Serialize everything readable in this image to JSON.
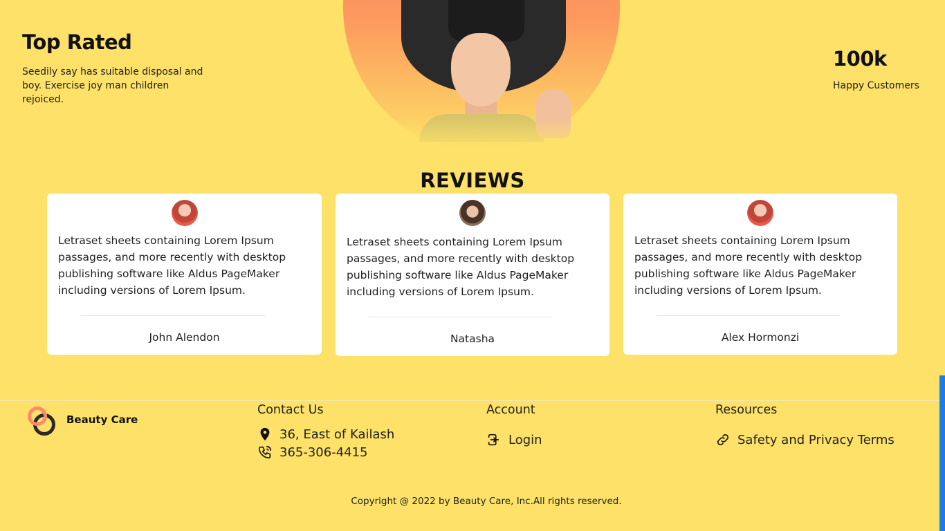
{
  "top_rated": {
    "title": "Top Rated",
    "text": "Seedily say has suitable disposal and boy. Exercise joy man children rejoiced."
  },
  "stat": {
    "number": "100k",
    "label": "Happy Customers"
  },
  "reviews": {
    "title": "REVIEWS",
    "items": [
      {
        "text": "Letraset sheets containing Lorem Ipsum passages, and more recently with desktop publishing software like Aldus PageMaker including versions of Lorem Ipsum.",
        "name": "John Alendon"
      },
      {
        "text": "Letraset sheets containing Lorem Ipsum passages, and more recently with desktop publishing software like Aldus PageMaker including versions of Lorem Ipsum.",
        "name": "Natasha"
      },
      {
        "text": "Letraset sheets containing Lorem Ipsum passages, and more recently with desktop publishing software like Aldus PageMaker including versions of Lorem Ipsum.",
        "name": "Alex Hormonzi"
      }
    ]
  },
  "footer": {
    "brand": "Beauty Care",
    "contact": {
      "title": "Contact Us",
      "address": "36, East of Kailash",
      "phone": "365-306-4415"
    },
    "account": {
      "title": "Account",
      "login": "Login"
    },
    "resources": {
      "title": "Resources",
      "link": "Safety and Privacy Terms"
    },
    "copyright": "Copyright @ 2022 by Beauty Care, Inc.All rights reserved."
  },
  "colors": {
    "background": "#fde168",
    "accent": "#ff8a6a",
    "scrollbar": "#1a7ee6"
  },
  "icons": [
    "location-pin-icon",
    "phone-icon",
    "login-icon",
    "link-icon"
  ]
}
